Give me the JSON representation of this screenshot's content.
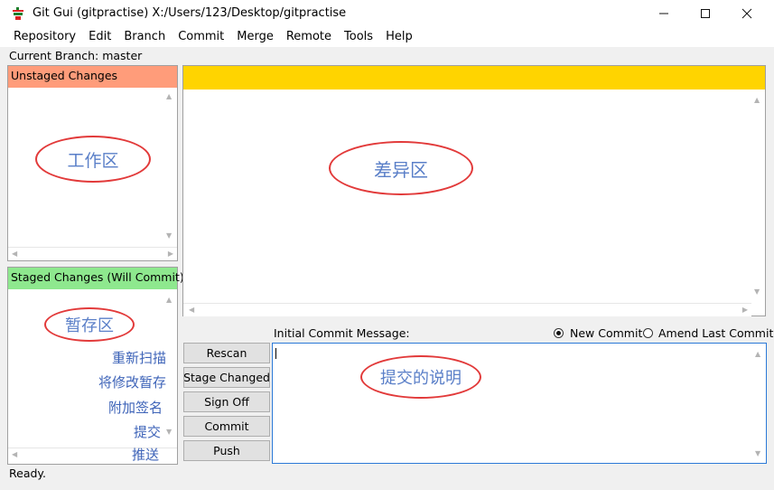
{
  "window": {
    "title": "Git Gui (gitpractise) X:/Users/123/Desktop/gitpractise",
    "app_icon": "git-gui-icon",
    "controls": [
      "minimize-icon",
      "maximize-icon",
      "close-icon"
    ]
  },
  "menu": {
    "items": [
      "Repository",
      "Edit",
      "Branch",
      "Commit",
      "Merge",
      "Remote",
      "Tools",
      "Help"
    ]
  },
  "branch": {
    "text": "Current Branch: master"
  },
  "unstaged": {
    "header": "Unstaged Changes",
    "header_color": "#ff9c7a",
    "annotation": "工作区"
  },
  "staged": {
    "header": "Staged Changes (Will Commit)",
    "header_color": "#8ee88e",
    "annotation": "暂存区",
    "side_labels": [
      "重新扫描",
      "将修改暂存",
      "附加签名",
      "提交",
      "推送"
    ]
  },
  "diff": {
    "header_color": "#ffd400",
    "annotation": "差异区"
  },
  "commit": {
    "message_label": "Initial Commit Message:",
    "options": [
      {
        "label": "New Commit",
        "selected": true
      },
      {
        "label": "Amend Last Commit",
        "selected": false
      }
    ],
    "annotation": "提交的说明"
  },
  "buttons": {
    "rescan": "Rescan",
    "stage_changed": "Stage Changed",
    "sign_off": "Sign Off",
    "commit": "Commit",
    "push": "Push"
  },
  "status": {
    "text": "Ready."
  },
  "annotation_color": "#e23a3a"
}
